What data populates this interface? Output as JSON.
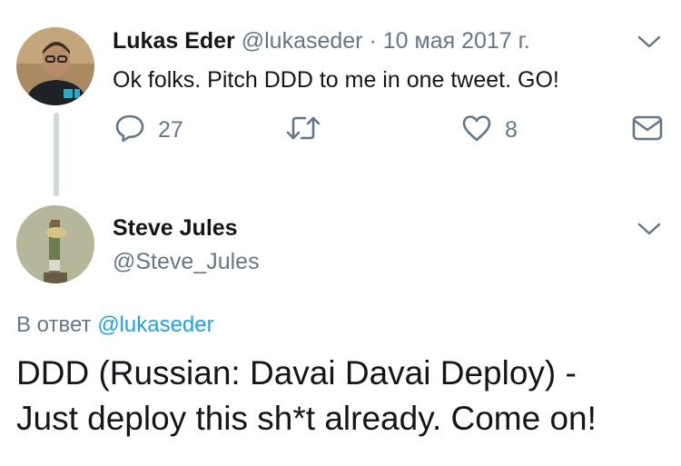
{
  "tweet1": {
    "author_name": "Lukas Eder",
    "author_handle": "@lukaseder",
    "separator": "·",
    "date": "10 мая 2017 г.",
    "text": "Ok folks. Pitch DDD to me in one tweet. GO!",
    "actions": {
      "reply_count": "27",
      "retweet_count": "",
      "like_count": "8"
    }
  },
  "tweet2": {
    "author_name": "Steve Jules",
    "author_handle": "@Steve_Jules",
    "reply_prefix": "В ответ",
    "reply_to": "@lukaseder",
    "text_line1": "DDD (Russian: Davai Davai Deploy) -",
    "text_line2": "Just deploy this sh*t already. Come on!"
  },
  "colors": {
    "text": "#14171a",
    "muted": "#657786",
    "link": "#1da1f2",
    "thread_line": "#cfd9de"
  },
  "icons": [
    "chevron-down-icon",
    "reply-icon",
    "retweet-icon",
    "like-icon",
    "dm-icon"
  ]
}
